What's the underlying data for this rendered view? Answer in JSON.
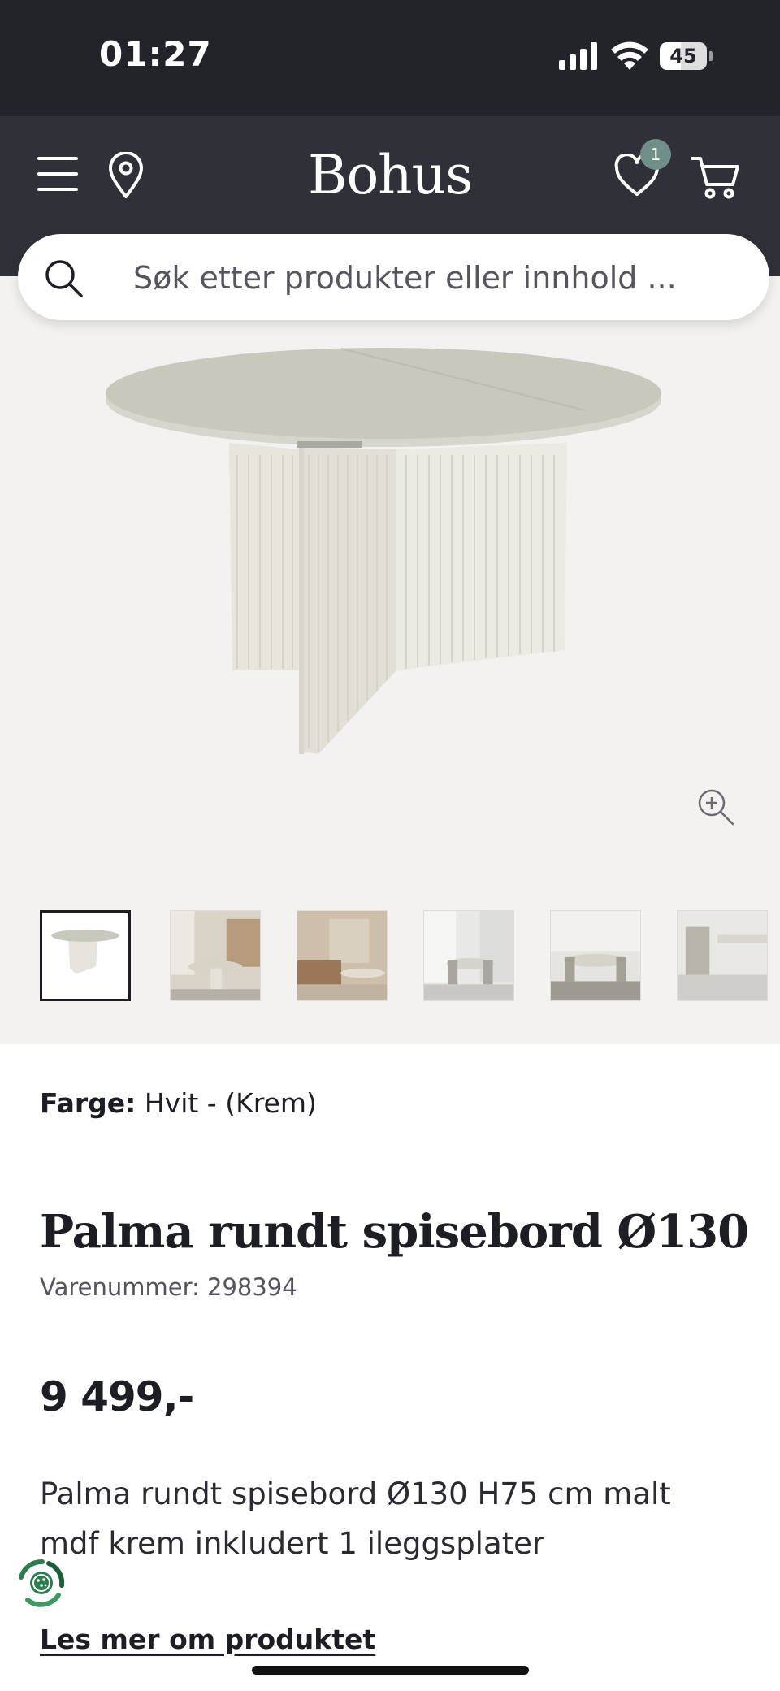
{
  "status_bar": {
    "time": "01:27",
    "battery": "45",
    "battery_level": 0.45
  },
  "header": {
    "logo": "Bohus",
    "wishlist_count": "1"
  },
  "search": {
    "placeholder": "Søk etter produkter eller innhold ..."
  },
  "gallery": {
    "thumbnail_count": 6,
    "selected_thumbnail": 1
  },
  "product": {
    "color_label": "Farge:",
    "color_value": "Hvit - (Krem)",
    "title": "Palma rundt spisebord Ø130",
    "sku": "Varenummer: 298394",
    "price": "9 499,-",
    "description": "Palma rundt spisebord Ø130 H75 cm malt mdf krem inkludert 1 ileggsplater",
    "read_more": "Les mer om produktet"
  },
  "icons": {
    "menu": "hamburger-menu-icon",
    "location": "map-pin-icon",
    "wishlist": "heart-icon",
    "cart": "shopping-cart-icon",
    "search": "magnifier-icon",
    "zoom": "zoom-in-icon",
    "eco": "recycle-badge-icon"
  },
  "colors": {
    "status_bar": "#23232a",
    "header": "#303039",
    "gallery_bg": "#f3f2f0",
    "badge": "#6f8f88"
  }
}
